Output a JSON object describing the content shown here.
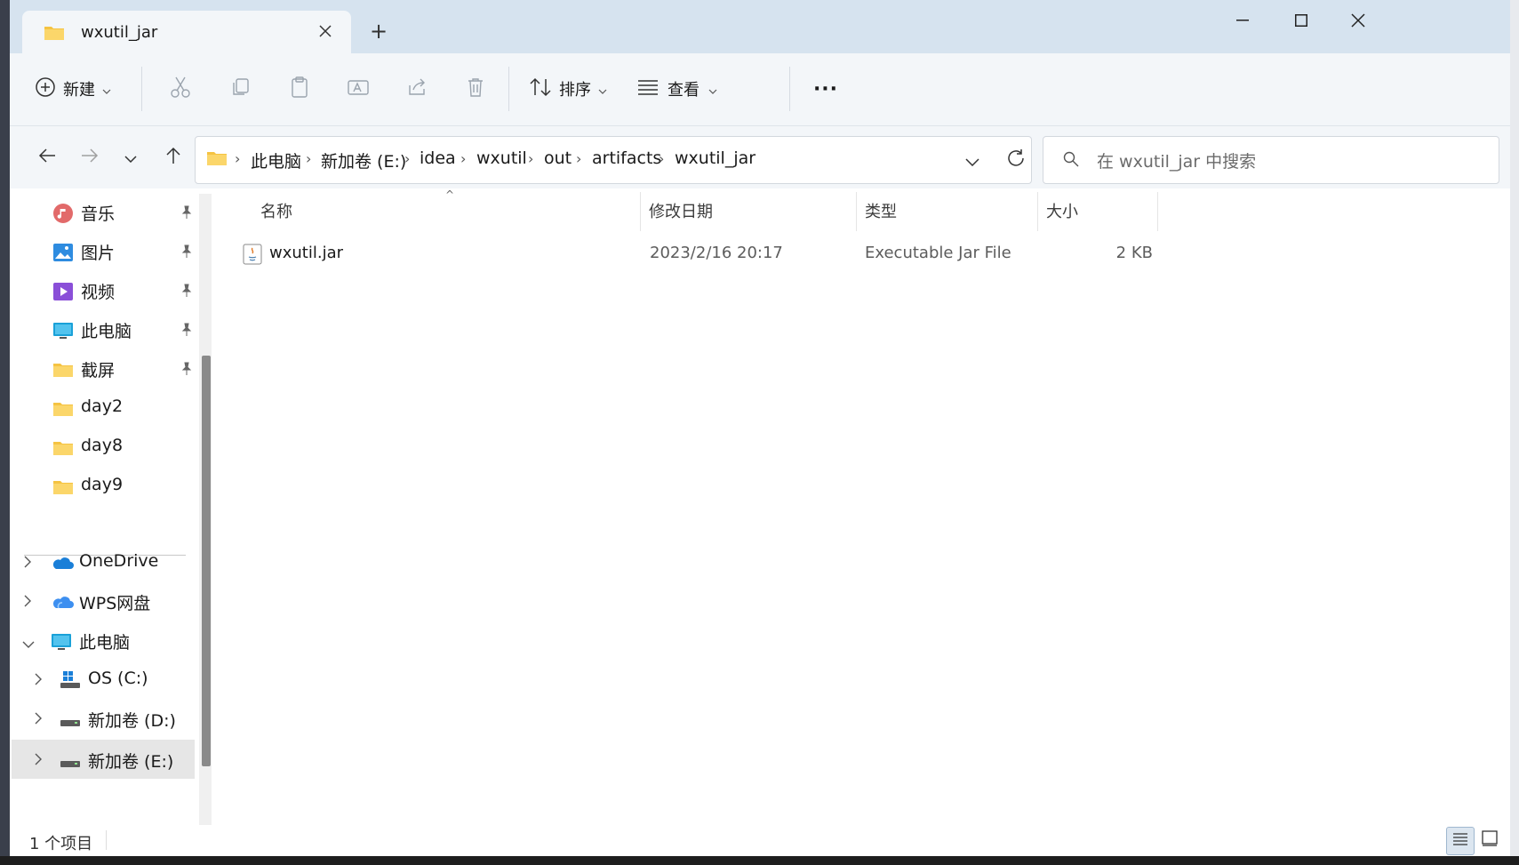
{
  "window": {
    "tab_title": "wxutil_jar",
    "new_tab_label": "+",
    "minimize": "—",
    "maximize": "☐",
    "close": "✕"
  },
  "toolbar": {
    "new_label": "新建",
    "sort_label": "排序",
    "view_label": "查看",
    "more_label": "···"
  },
  "address": {
    "crumbs": [
      "此电脑",
      "新加卷 (E:)",
      "idea",
      "wxutil",
      "out",
      "artifacts",
      "wxutil_jar"
    ]
  },
  "search": {
    "placeholder": "在 wxutil_jar 中搜索"
  },
  "sidebar": {
    "quick_access": [
      {
        "label": "音乐",
        "icon": "music-icon",
        "pinned": true
      },
      {
        "label": "图片",
        "icon": "pictures-icon",
        "pinned": true
      },
      {
        "label": "视频",
        "icon": "videos-icon",
        "pinned": true
      },
      {
        "label": "此电脑",
        "icon": "this-pc-icon",
        "pinned": true
      },
      {
        "label": "截屏",
        "icon": "folder-icon",
        "pinned": true
      },
      {
        "label": "day2",
        "icon": "folder-icon",
        "pinned": false
      },
      {
        "label": "day8",
        "icon": "folder-icon",
        "pinned": false
      },
      {
        "label": "day9",
        "icon": "folder-icon",
        "pinned": false
      }
    ],
    "tree": [
      {
        "label": "OneDrive",
        "icon": "onedrive-icon",
        "expanded": false
      },
      {
        "label": "WPS网盘",
        "icon": "wps-cloud-icon",
        "expanded": false
      },
      {
        "label": "此电脑",
        "icon": "this-pc-icon",
        "expanded": true
      },
      {
        "label": "OS (C:)",
        "icon": "windows-drive-icon",
        "expanded": false
      },
      {
        "label": "新加卷 (D:)",
        "icon": "drive-icon",
        "expanded": false
      },
      {
        "label": "新加卷 (E:)",
        "icon": "drive-icon",
        "expanded": false
      }
    ]
  },
  "columns": {
    "name": "名称",
    "modified": "修改日期",
    "type": "类型",
    "size": "大小"
  },
  "files": [
    {
      "name": "wxutil.jar",
      "modified": "2023/2/16 20:17",
      "type": "Executable Jar File",
      "size": "2 KB"
    }
  ],
  "status": {
    "count_text": "1 个项目"
  },
  "colors": {
    "titlebar": "#d6e3ef",
    "toolbar": "#f3f6f9",
    "folder": "#f5c342",
    "selected_nav": "#e6e6e6"
  }
}
